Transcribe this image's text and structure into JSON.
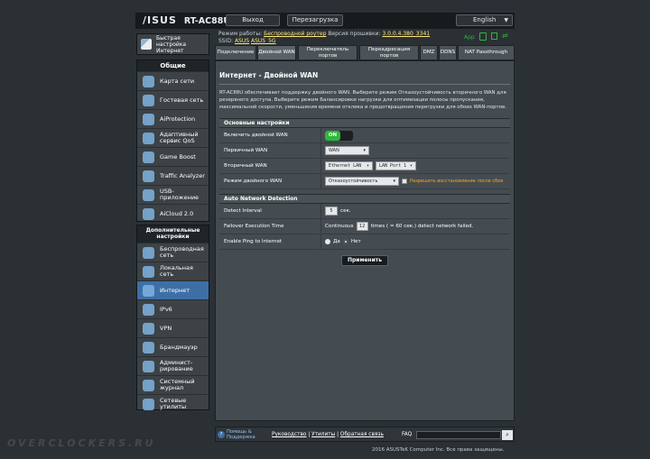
{
  "header": {
    "brand": "/ISUS",
    "model": "RT-AC88U",
    "logout_label": "Выход",
    "reboot_label": "Перезагрузка",
    "language": "English"
  },
  "status": {
    "mode_label": "Режим работы:",
    "mode_value": "Беспроводной роутер",
    "firmware_label": "Версия прошивки:",
    "firmware_value": "3.0.0.4.380_3341",
    "ssid_label": "SSID:",
    "ssid_1": "ASUS",
    "ssid_2": "ASUS_5G",
    "app_label": "App"
  },
  "sidebar": {
    "quick_setup": "Быстрая настройка Интернет",
    "general_header": "Общие",
    "general_items": [
      {
        "label": "Карта сети"
      },
      {
        "label": "Гостевая сеть"
      },
      {
        "label": "AiProtection"
      },
      {
        "label": "Адаптивный сервис QoS"
      },
      {
        "label": "Game Boost"
      },
      {
        "label": "Traffic Analyzer"
      },
      {
        "label": "USB-приложение"
      },
      {
        "label": "AiCloud 2.0"
      }
    ],
    "advanced_header": "Дополнительные настройки",
    "advanced_items": [
      {
        "label": "Беспроводная сеть"
      },
      {
        "label": "Локальная сеть"
      },
      {
        "label": "Интернет"
      },
      {
        "label": "IPv6"
      },
      {
        "label": "VPN"
      },
      {
        "label": "Брандмауэр"
      },
      {
        "label": "Админист-рирование"
      },
      {
        "label": "Системный журнал"
      },
      {
        "label": "Сетевые утилиты"
      }
    ]
  },
  "tabs": [
    {
      "label": "Подключение"
    },
    {
      "label": "Двойной WAN"
    },
    {
      "label": "Переключатель портов"
    },
    {
      "label": "Переадресация портов"
    },
    {
      "label": "DMZ"
    },
    {
      "label": "DDNS"
    },
    {
      "label": "NAT Passthrough"
    }
  ],
  "page": {
    "title": "Интернет - Двойной WAN",
    "description": "RT-AC88U обеспечивает поддержку двойного WAN. Выберите режим Отказоустойчивость вторичного WAN для резервного доступа. Выберите режим Балансировки нагрузки для оптимизации полосы пропускания, максимальной скорости, уменьшения времени отклика и предотвращения перегрузки для обоих WAN-портов.",
    "basic": {
      "header": "Основные настройки",
      "enable_label": "Включить двойной WAN",
      "enable_value": "ON",
      "primary_label": "Первичный WAN",
      "primary_value": "WAN",
      "secondary_label": "Вторичный WAN",
      "secondary_value": "Ethernet LAN",
      "secondary_port": "LAN Port 1",
      "mode_label": "Режим двойного WAN",
      "mode_value": "Отказоустойчивость",
      "failback_label": "Разрешить восстановление после сбоя"
    },
    "detection": {
      "header": "Auto Network Detection",
      "interval_label": "Detect Interval",
      "interval_value": "5",
      "interval_unit": "сек.",
      "failover_label": "Failover Execution Time",
      "failover_prefix": "Continuous",
      "failover_value": "12",
      "failover_suffix": "times ( = 60 сек.) detect network failed.",
      "ping_label": "Enable Ping to Internet",
      "ping_yes": "Да",
      "ping_no": "Нет"
    },
    "apply_label": "Применить"
  },
  "footer": {
    "help": "Помощь & Поддержка",
    "manual": "Руководство",
    "utils": "Утилиты",
    "feedback": "Обратная связь",
    "faq": "FAQ",
    "copyright": "2016 ASUSTeK Computer Inc. Все права защищены.",
    "watermark": "OVERCLOCKERS.RU"
  },
  "colors": {
    "accent": "#3d6fa6",
    "on_green": "#2cb83c",
    "link_yellow": "#ffe680",
    "warn_orange": "#ffa726"
  }
}
